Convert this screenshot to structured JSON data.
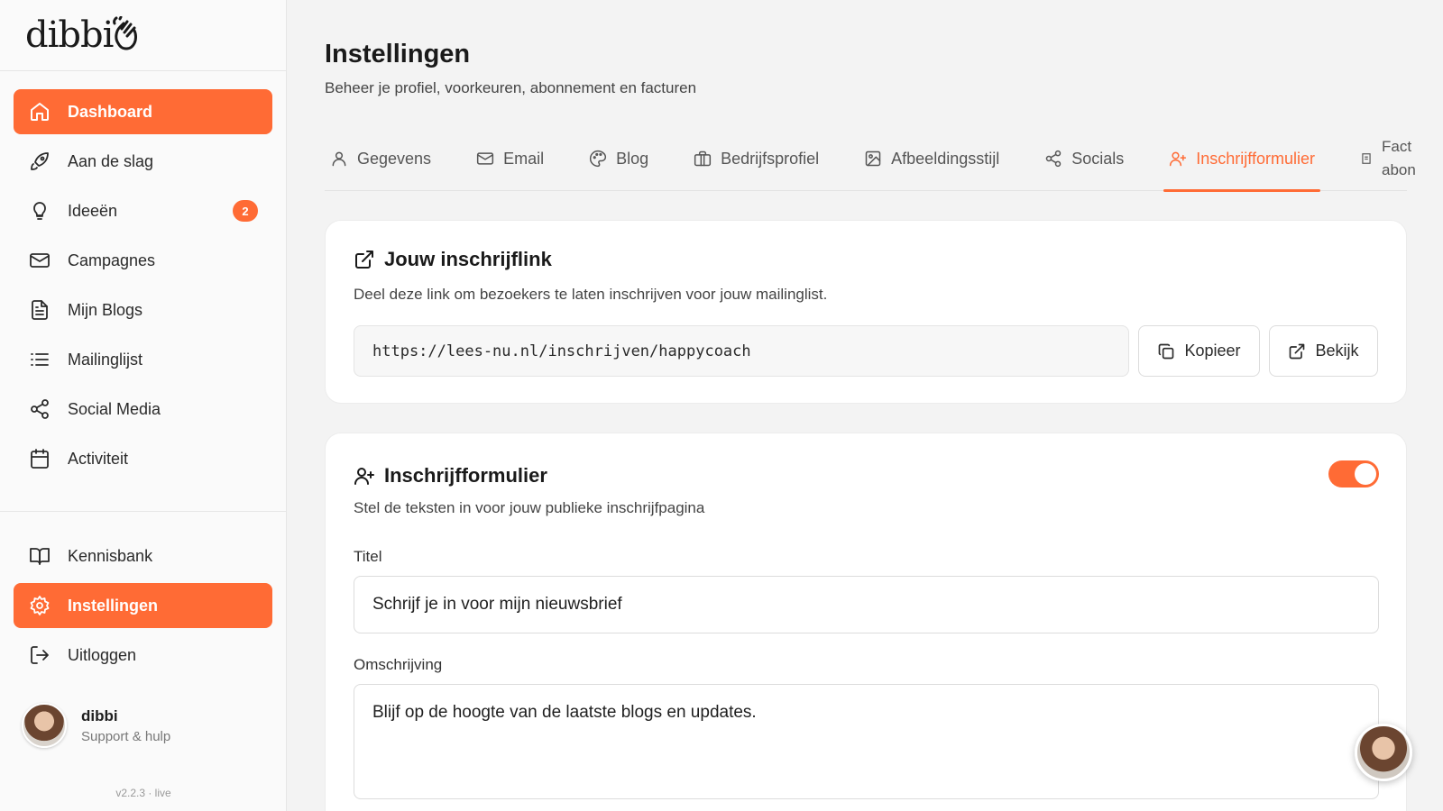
{
  "brand": {
    "logo_text": "dibbi",
    "accent": "#ff6b35"
  },
  "sidebar": {
    "items": [
      {
        "label": "Dashboard",
        "icon": "home-icon",
        "active": true
      },
      {
        "label": "Aan de slag",
        "icon": "rocket-icon"
      },
      {
        "label": "Ideeën",
        "icon": "lightbulb-icon",
        "badge": "2"
      },
      {
        "label": "Campagnes",
        "icon": "mail-icon"
      },
      {
        "label": "Mijn Blogs",
        "icon": "document-icon"
      },
      {
        "label": "Mailinglijst",
        "icon": "list-icon"
      },
      {
        "label": "Social Media",
        "icon": "share-icon"
      },
      {
        "label": "Activiteit",
        "icon": "calendar-icon"
      }
    ],
    "bottom_items": [
      {
        "label": "Kennisbank",
        "icon": "book-icon"
      },
      {
        "label": "Instellingen",
        "icon": "gear-icon",
        "active": true
      },
      {
        "label": "Uitloggen",
        "icon": "logout-icon"
      }
    ],
    "user": {
      "name": "dibbi",
      "subtitle": "Support & hulp"
    },
    "version": "v2.2.3 · live"
  },
  "header": {
    "title": "Instellingen",
    "subtitle": "Beheer je profiel, voorkeuren, abonnement en facturen"
  },
  "tabs": [
    {
      "label": "Gegevens",
      "icon": "user-icon"
    },
    {
      "label": "Email",
      "icon": "mail-icon"
    },
    {
      "label": "Blog",
      "icon": "palette-icon"
    },
    {
      "label": "Bedrijfsprofiel",
      "icon": "briefcase-icon"
    },
    {
      "label": "Afbeeldingsstijl",
      "icon": "image-icon"
    },
    {
      "label": "Socials",
      "icon": "share-icon"
    },
    {
      "label": "Inschrijfformulier",
      "icon": "user-plus-icon",
      "active": true
    },
    {
      "label": "Fact abon",
      "icon": "receipt-icon"
    }
  ],
  "signup_link_card": {
    "title": "Jouw inschrijflink",
    "description": "Deel deze link om bezoekers te laten inschrijven voor jouw mailinglist.",
    "url": "https://lees-nu.nl/inschrijven/happycoach",
    "copy_label": "Kopieer",
    "view_label": "Bekijk"
  },
  "form_card": {
    "title": "Inschrijfformulier",
    "description": "Stel de teksten in voor jouw publieke inschrijfpagina",
    "enabled": true,
    "title_label": "Titel",
    "title_value": "Schrijf je in voor mijn nieuwsbrief",
    "description_label": "Omschrijving",
    "description_value": "Blijf op de hoogte van de laatste blogs en updates."
  }
}
